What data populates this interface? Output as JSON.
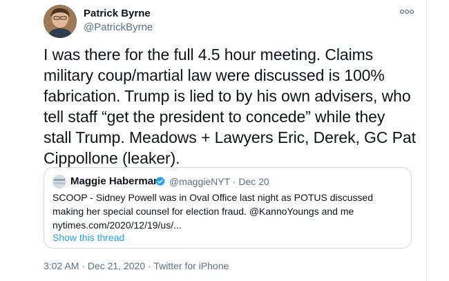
{
  "tweet": {
    "author_name": "Patrick Byrne",
    "author_handle": "@PatrickByrne",
    "text": "I was there for the full 4.5 hour meeting. Claims military coup/martial law were discussed is 100% fabrication. Trump is lied to by his own advisers, who tell staff “get the president to concede” while they stall Trump. Meadows + Lawyers Eric, Derek, GC Pat Cippollone (leaker).",
    "icons": {
      "more": "more-horizontal-icon"
    }
  },
  "quote": {
    "author_name": "Maggie Haberman",
    "verified": true,
    "author_handle": "@maggieNYT",
    "separator": "·",
    "date": "Dec 20",
    "text": "SCOOP - Sidney Powell was in Oval Office last night as POTUS discussed making her special counsel for election fraud. @KannoYoungs and me nytimes.com/2020/12/19/us/...",
    "show_thread": "Show this thread",
    "verified_color": "#1da1f2"
  },
  "footer": {
    "time": "3:02 AM",
    "date": "Dec 21, 2020",
    "source": "Twitter for iPhone",
    "separator": "·"
  },
  "colors": {
    "text": "#0f1419",
    "secondary": "#5b7083",
    "link": "#1da1f2",
    "border": "#cfd9de"
  }
}
